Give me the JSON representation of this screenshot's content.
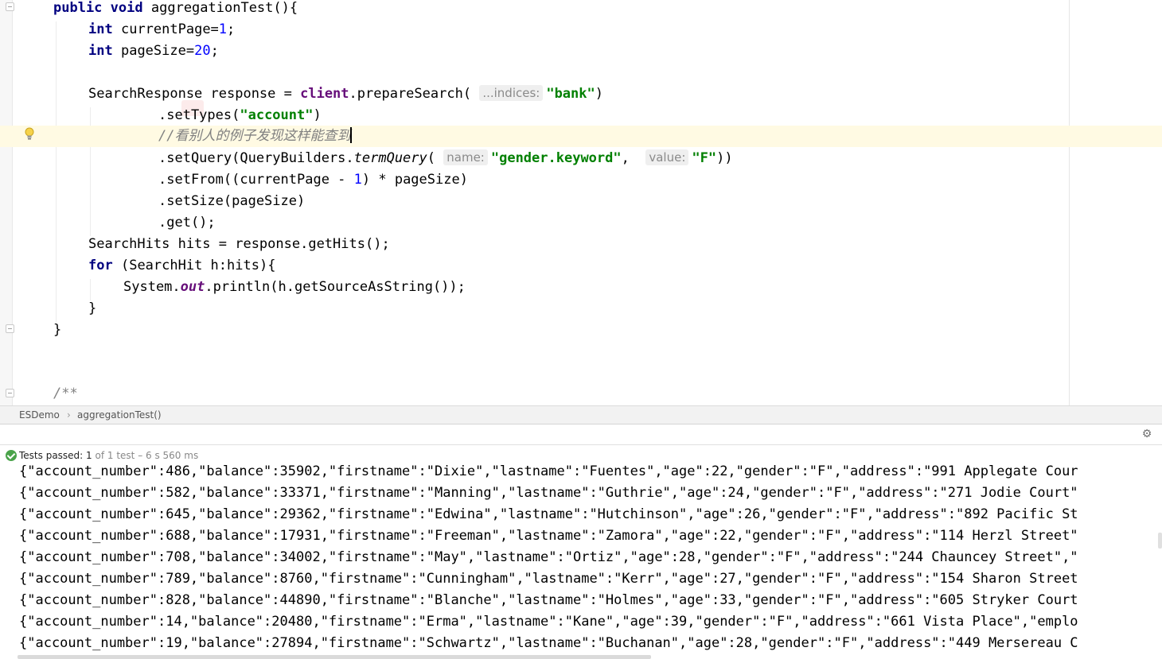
{
  "editor": {
    "code": {
      "l1_kw1": "public",
      "l1_kw2": "void",
      "l1_rest": "aggregationTest(){",
      "l2_kw": "int",
      "l2_name": "currentPage=",
      "l2_num": "1",
      "l2_end": ";",
      "l3_kw": "int",
      "l3_name": "pageSize=",
      "l3_num": "20",
      "l3_end": ";",
      "l5_a": "SearchResponse response = ",
      "l5_field": "client",
      "l5_b": ".prepareSearch(",
      "l5_hint": "...indices:",
      "l5_str": "\"bank\"",
      "l5_end": ")",
      "l6_a": ".setTypes(",
      "l6_str": "\"account\"",
      "l6_end": ")",
      "l7_comment": "//看别人的例子发现这样能查到",
      "l8_a": ".setQuery(QueryBuilders.",
      "l8_method": "termQuery",
      "l8_paren": "(",
      "l8_hint1": "name:",
      "l8_str1": "\"gender.keyword\"",
      "l8_comma": ",",
      "l8_hint2": "value:",
      "l8_str2": "\"F\"",
      "l8_end": "))",
      "l9_a": ".setFrom((currentPage - ",
      "l9_num": "1",
      "l9_b": ") * pageSize)",
      "l10": ".setSize(pageSize)",
      "l11": ".get();",
      "l12": "SearchHits hits = response.getHits();",
      "l13_kw": "for",
      "l13_rest": "(SearchHit h:hits){",
      "l14_a": "System.",
      "l14_field": "out",
      "l14_b": ".println(h.getSourceAsString());",
      "l15": "}",
      "l16": "}",
      "l19": "/**"
    }
  },
  "breadcrumb": {
    "class_name": "ESDemo",
    "separator": "›",
    "method_name": "aggregationTest()"
  },
  "run_panel": {
    "settings_icon": "gear-icon",
    "status": {
      "passed_label": "Tests passed:",
      "passed_count": "1",
      "detail": "of 1 test – 6 s 560 ms"
    },
    "output_lines": [
      "{\"account_number\":486,\"balance\":35902,\"firstname\":\"Dixie\",\"lastname\":\"Fuentes\",\"age\":22,\"gender\":\"F\",\"address\":\"991 Applegate Cour",
      "{\"account_number\":582,\"balance\":33371,\"firstname\":\"Manning\",\"lastname\":\"Guthrie\",\"age\":24,\"gender\":\"F\",\"address\":\"271 Jodie Court\"",
      "{\"account_number\":645,\"balance\":29362,\"firstname\":\"Edwina\",\"lastname\":\"Hutchinson\",\"age\":26,\"gender\":\"F\",\"address\":\"892 Pacific St",
      "{\"account_number\":688,\"balance\":17931,\"firstname\":\"Freeman\",\"lastname\":\"Zamora\",\"age\":22,\"gender\":\"F\",\"address\":\"114 Herzl Street\"",
      "{\"account_number\":708,\"balance\":34002,\"firstname\":\"May\",\"lastname\":\"Ortiz\",\"age\":28,\"gender\":\"F\",\"address\":\"244 Chauncey Street\",\"",
      "{\"account_number\":789,\"balance\":8760,\"firstname\":\"Cunningham\",\"lastname\":\"Kerr\",\"age\":27,\"gender\":\"F\",\"address\":\"154 Sharon Street",
      "{\"account_number\":828,\"balance\":44890,\"firstname\":\"Blanche\",\"lastname\":\"Holmes\",\"age\":33,\"gender\":\"F\",\"address\":\"605 Stryker Court",
      "{\"account_number\":14,\"balance\":20480,\"firstname\":\"Erma\",\"lastname\":\"Kane\",\"age\":39,\"gender\":\"F\",\"address\":\"661 Vista Place\",\"emplo",
      "{\"account_number\":19,\"balance\":27894,\"firstname\":\"Schwartz\",\"lastname\":\"Buchanan\",\"age\":28,\"gender\":\"F\",\"address\":\"449 Mersereau C"
    ]
  }
}
